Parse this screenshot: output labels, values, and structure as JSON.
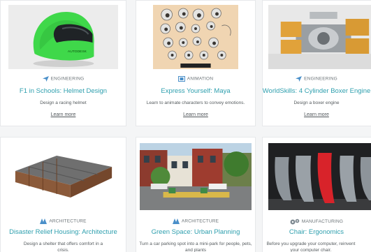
{
  "colors": {
    "accent": "#2e9fae",
    "category_icon": "#4a8fc9",
    "page_bg": "#f4f5f6"
  },
  "cards": [
    {
      "category": "ENGINEERING",
      "category_icon": "paper-plane-icon",
      "title": "F1 in Schools: Helmet Design",
      "description": "Design a racing helmet",
      "link": "Learn more",
      "image": "green-helmet-image",
      "helmet_text": "AUTODESK"
    },
    {
      "category": "ANIMATION",
      "category_icon": "film-icon",
      "title": "Express Yourself: Maya",
      "description": "Learn to animate characters to convey emotions.",
      "link": "Learn more",
      "image": "eyeball-sketch-image"
    },
    {
      "category": "ENGINEERING",
      "category_icon": "paper-plane-icon",
      "title": "WorldSkills: 4 Cylinder Boxer Engine",
      "description": "Design a boxer engine",
      "link": "Learn more",
      "image": "boxer-engine-image"
    },
    {
      "category": "ARCHITECTURE",
      "category_icon": "blueprint-icon",
      "title": "Disaster Relief Housing: Architecture",
      "description": "Design a shelter that offers comfort in a crisis.",
      "link": "",
      "image": "relief-housing-image"
    },
    {
      "category": "ARCHITECTURE",
      "category_icon": "blueprint-icon",
      "title": "Green Space: Urban Planning",
      "description": "Turn a car parking spot into a mini-park for people, pets, and plants",
      "link": "",
      "image": "street-parklet-image"
    },
    {
      "category": "MANUFACTURING",
      "category_icon": "gears-icon",
      "title": "Chair: Ergonomics",
      "description": "Before you upgrade your computer, reinvent your computer chair.",
      "link": "",
      "image": "chairs-image"
    }
  ]
}
